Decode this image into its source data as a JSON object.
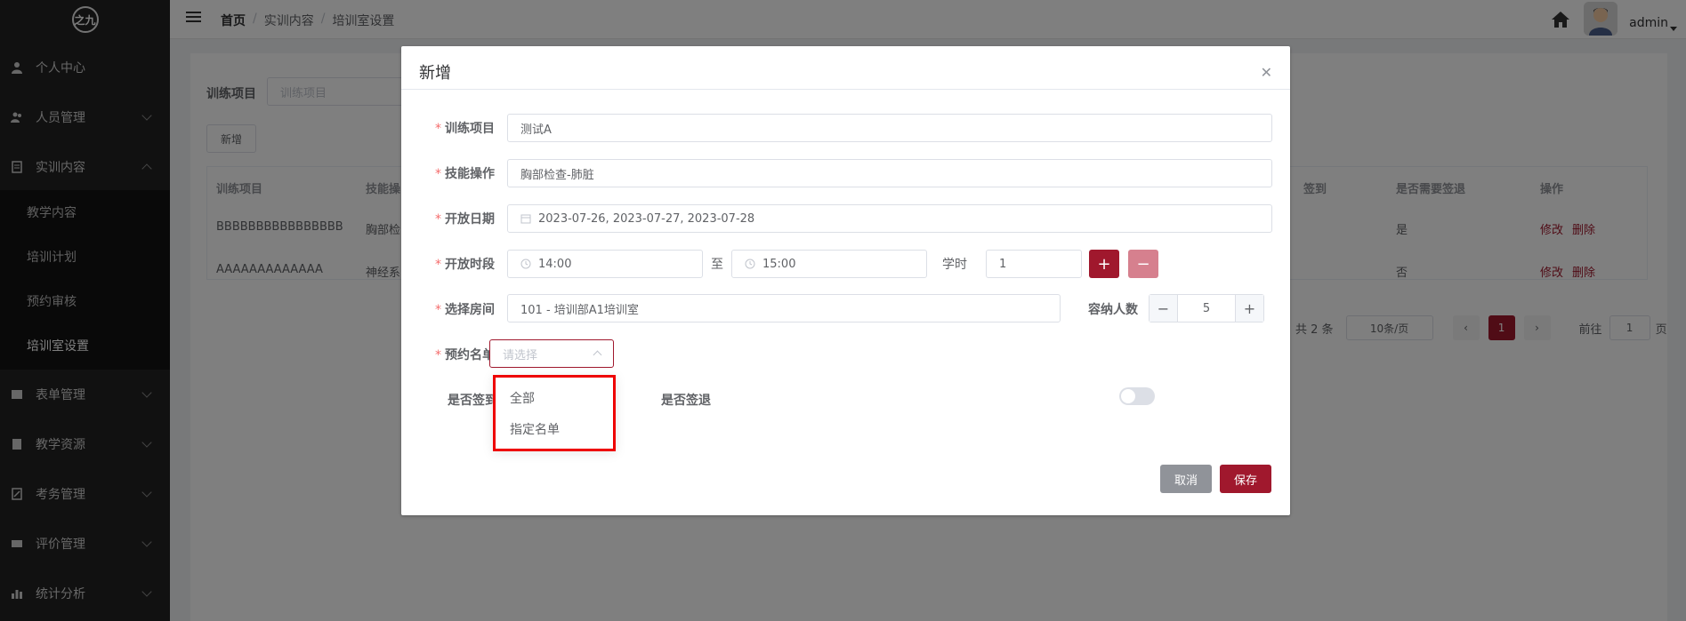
{
  "logo_text": "之九",
  "sidebar": {
    "items": [
      {
        "label": "个人中心",
        "icon": "user-icon"
      },
      {
        "label": "人员管理",
        "icon": "users-icon"
      },
      {
        "label": "实训内容",
        "icon": "book-icon"
      },
      {
        "label": "表单管理",
        "icon": "form-icon"
      },
      {
        "label": "教学资源",
        "icon": "resource-icon"
      },
      {
        "label": "考务管理",
        "icon": "exam-icon"
      },
      {
        "label": "评价管理",
        "icon": "evaluate-icon"
      },
      {
        "label": "统计分析",
        "icon": "chart-icon"
      }
    ],
    "submenu": [
      "教学内容",
      "培训计划",
      "预约审核",
      "培训室设置"
    ]
  },
  "header": {
    "breadcrumb": [
      "首页",
      "实训内容",
      "培训室设置"
    ],
    "user": "admin"
  },
  "background": {
    "filter_label": "训练项目",
    "filter_placeholder": "训练项目",
    "add_button": "新增",
    "table": {
      "headers": [
        "训练项目",
        "技能操",
        "签到",
        "是否需要签退",
        "操作"
      ],
      "rows": [
        {
          "project": "BBBBBBBBBBBBBBBB",
          "skill": "胸部检",
          "need_signout": "是"
        },
        {
          "project": "AAAAAAAAAAAAA",
          "skill": "神经系",
          "need_signout": "否"
        }
      ],
      "action_edit": "修改",
      "action_delete": "删除"
    },
    "pager": {
      "total": "共 2 条",
      "page_size": "10条/页",
      "current_page": "1",
      "goto_label": "前往",
      "goto_value": "1",
      "page_suffix": "页"
    }
  },
  "dialog": {
    "title": "新增",
    "fields": {
      "project_label": "训练项目",
      "project_value": "测试A",
      "skill_label": "技能操作",
      "skill_value": "胸部检查-肺脏",
      "date_label": "开放日期",
      "date_value": "2023-07-26, 2023-07-27, 2023-07-28",
      "time_label": "开放时段",
      "time_start": "14:00",
      "time_to": "至",
      "time_end": "15:00",
      "hours_label": "学时",
      "hours_value": "1",
      "room_label": "选择房间",
      "room_value": "101 - 培训部A1培训室",
      "capacity_label": "容纳人数",
      "capacity_value": "5",
      "list_label": "预约名单",
      "list_placeholder": "请选择",
      "signin_label": "是否签到",
      "signout_label": "是否签退"
    },
    "dropdown_options": [
      "全部",
      "指定名单"
    ],
    "cancel": "取消",
    "save": "保存"
  },
  "colors": {
    "accent": "#a0182d",
    "accent_light": "#d6808e",
    "highlight": "#e00000"
  }
}
